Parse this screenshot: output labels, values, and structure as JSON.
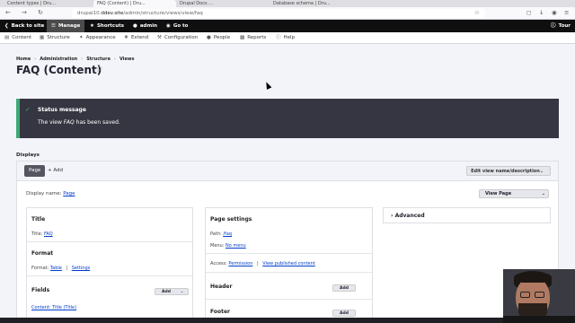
{
  "browser": {
    "tabs": [
      {
        "label": "Content types | Dru...",
        "active": false
      },
      {
        "label": "FAQ (Content) | Dru...",
        "active": true
      },
      {
        "label": "Drupal Docs ...",
        "active": false
      },
      {
        "label": "Database schema | Dru...",
        "active": false
      }
    ],
    "url_prefix": "drupal10.",
    "url_domain": "ddev.site",
    "url_path": "/admin/structure/views/view/faq"
  },
  "toolbar": {
    "back": "Back to site",
    "manage": "Manage",
    "shortcuts": "Shortcuts",
    "user": "admin",
    "goto": "Go to",
    "tour": "Tour"
  },
  "tray": {
    "items": [
      "Content",
      "Structure",
      "Appearance",
      "Extend",
      "Configuration",
      "People",
      "Reports",
      "Help"
    ]
  },
  "breadcrumb": [
    "Home",
    "Administration",
    "Structure",
    "Views"
  ],
  "page_title": "FAQ (Content)",
  "status": {
    "title": "Status message",
    "msg_before": "The view ",
    "msg_name": "FAQ",
    "msg_after": " has been saved."
  },
  "displays": {
    "label": "Displays",
    "page_tab": "Page",
    "add": "+ Add",
    "edit_btn": "Edit view name/description",
    "display_name_label": "Display name:",
    "display_name_value": "Page",
    "view_page_btn": "View Page"
  },
  "col1": {
    "title_h": "Title",
    "title_label": "Title:",
    "title_value": "FAQ",
    "format_h": "Format",
    "format_label": "Format:",
    "format_value": "Table",
    "format_sep": "|",
    "format_settings": "Settings",
    "fields_h": "Fields",
    "fields_add": "Add",
    "field_1": "Content: Title (Title)"
  },
  "col2": {
    "page_settings_h": "Page settings",
    "path_label": "Path:",
    "path_value": "/faq",
    "menu_label": "Menu:",
    "menu_value": "No menu",
    "access_label": "Access:",
    "access_value": "Permission",
    "access_sep": "|",
    "access_desc": "View published content",
    "header_h": "Header",
    "header_add": "Add",
    "footer_h": "Footer",
    "footer_add": "Add"
  },
  "col3": {
    "advanced": "Advanced"
  }
}
